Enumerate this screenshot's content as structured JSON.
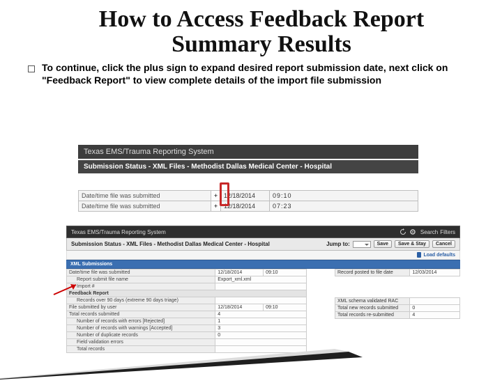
{
  "title": "How to Access Feedback Report Summary Results",
  "bullet": "To continue, click the plus sign to expand desired report submission date, next click on \"Feedback Report\" to view complete details of the import file submission",
  "shot1": {
    "header1": "Texas EMS/Trauma Reporting System",
    "header2": "Submission Status - XML Files - Methodist Dallas Medical Center - Hospital",
    "rows": [
      {
        "label": "Date/time file was submitted",
        "expand": "+",
        "date": "12/18/2014",
        "time": "09:10"
      },
      {
        "label": "Date/time file was submitted",
        "expand": "+",
        "date": "12/18/2014",
        "time": "07:23"
      }
    ]
  },
  "shot2": {
    "top_title": "Texas EMS/Trauma Reporting System",
    "jump_label": "Jump to:",
    "icons": {
      "refresh": "refresh-icon",
      "gear": "gear-icon"
    },
    "buttons": {
      "save": "Save",
      "save_stay": "Save & Stay",
      "cancel": "Cancel",
      "load_defaults": "Load defaults",
      "search": "Search",
      "filters": "Filters"
    },
    "sub_header": "Submission Status - XML Files - Methodist Dallas Medical Center - Hospital",
    "band_label": "XML Submissions",
    "left": [
      {
        "lbl": "Date/time file was submitted",
        "val_a": "12/18/2014",
        "val_b": "09:10"
      },
      {
        "lbl": "Report submit file name",
        "val": "Export_xml.xml",
        "val_b": ""
      },
      {
        "lbl": "Import #",
        "val": "",
        "val_b": ""
      },
      {
        "subheader": "Feedback Report"
      },
      {
        "lbl": "Records over 90 days (extreme 90 days triage)",
        "val": "",
        "val_b": ""
      },
      {
        "lbl": "File submitted by user",
        "val": "12/18/2014",
        "val_b": "09:10"
      },
      {
        "lbl": "Total records submitted",
        "val": "4",
        "val_b": ""
      },
      {
        "lbl": "Number of records with errors [Rejected]",
        "val": "1",
        "val_b": ""
      },
      {
        "lbl": "Number of records with warnings [Accepted]",
        "val": "3",
        "val_b": ""
      },
      {
        "lbl": "Number of duplicate records",
        "val": "0",
        "val_b": ""
      },
      {
        "lbl": "Field validation errors",
        "val": "",
        "val_b": ""
      },
      {
        "lbl": "Total records",
        "val": "",
        "val_b": ""
      }
    ],
    "right": [
      {
        "lbl": "Record posted to file date",
        "val": "12/03/2014"
      },
      {
        "spacer": true
      },
      {
        "lbl": "XML schema validated RAC",
        "val": ""
      },
      {
        "lbl": "Total new records submitted",
        "val": "0"
      },
      {
        "lbl": "Total records re-submitted",
        "val": "4"
      }
    ]
  }
}
